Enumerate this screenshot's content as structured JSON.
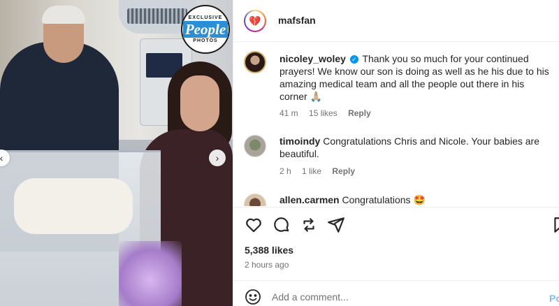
{
  "photo": {
    "badge": {
      "top": "EXCLUSIVE",
      "logo": "People",
      "bottom": "PHOTOS"
    },
    "nav_left_icon": "chevron-left-icon",
    "nav_right_icon": "chevron-right-icon",
    "left_glyph": "‹",
    "right_glyph": "›"
  },
  "header": {
    "username": "mafsfan",
    "avatar_glyph": "💔"
  },
  "comments": [
    {
      "user": "nicoley_woley",
      "verified": true,
      "text": "Thank you so much for your continued prayers! We know our son is doing as well as he his due to his amazing medical team and all the people out there in his corner 🙏🏼",
      "time": "41 m",
      "likes": "15 likes",
      "reply": "Reply"
    },
    {
      "user": "timoindy",
      "verified": false,
      "text": "Congratulations Chris and Nicole. Your babies are beautiful.",
      "time": "2 h",
      "likes": "1 like",
      "reply": "Reply"
    },
    {
      "user": "allen.carmen",
      "verified": false,
      "text": "Congratulations 🤩",
      "time": "",
      "likes": "",
      "reply": ""
    }
  ],
  "actions": {
    "icons": [
      "heart-icon",
      "comment-icon",
      "share-icon",
      "send-icon",
      "bookmark-icon"
    ]
  },
  "post": {
    "likes": "5,388 likes",
    "time": "2 hours ago"
  },
  "add_comment": {
    "placeholder": "Add a comment...",
    "post_label": "Post",
    "emoji_icon": "smiley-icon"
  },
  "colors": {
    "accent_blue": "#0095f6",
    "post_disabled": "#7fbef7",
    "text_primary": "#262626",
    "text_secondary": "#737373"
  }
}
